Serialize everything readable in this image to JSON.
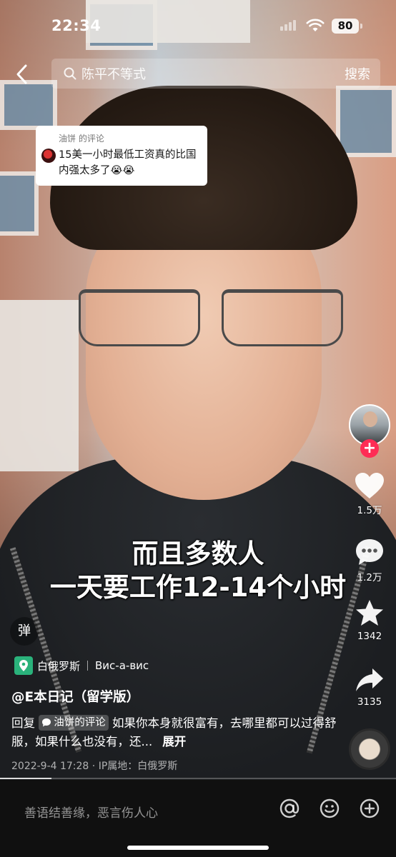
{
  "status_bar": {
    "time": "22:34",
    "battery": "80"
  },
  "search": {
    "query": "陈平不等式",
    "button": "搜索"
  },
  "quoted_comment": {
    "author_line": "油饼 的评论",
    "text": "15美一小时最低工资真的比国内强太多了😭😭"
  },
  "caption": {
    "line1": "而且多数人",
    "line2": "一天要工作12-14个小时"
  },
  "actions": {
    "likes": "1.5万",
    "comments": "1.2万",
    "favorites": "1342",
    "shares": "3135"
  },
  "danmu_label": "弹",
  "location": {
    "name": "白俄罗斯",
    "secondary": "Вис-а-вис"
  },
  "author": {
    "handle": "@E本日记（留学版）"
  },
  "description": {
    "prefix": "回复",
    "chip_label": "油饼的评论",
    "body": " 如果你本身就很富有，去哪里都可以过得舒服，如果什么也没有，还...",
    "expand": "展开"
  },
  "meta": {
    "date_location": "2022-9-4 17:28 · IP属地：白俄罗斯"
  },
  "progress": {
    "fraction": 0.13
  },
  "comment_input": {
    "placeholder": "善语结善缘，恶言伤人心"
  },
  "colors": {
    "accent": "#fe2c55",
    "location_green": "#2ab27b"
  }
}
